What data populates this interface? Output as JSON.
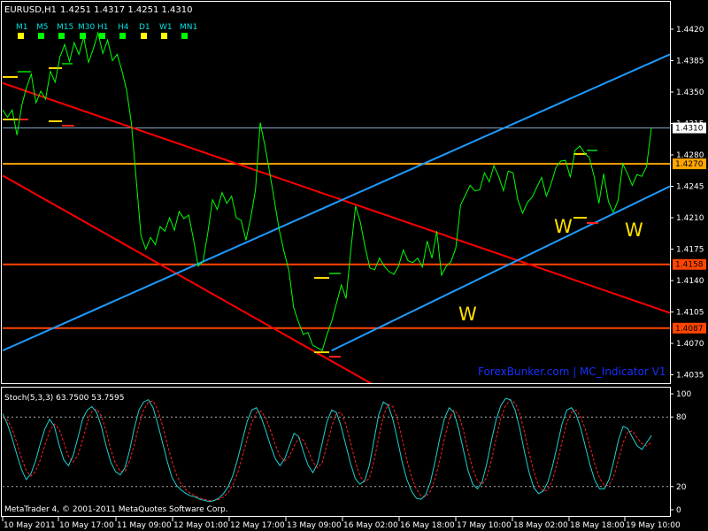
{
  "header": {
    "symbol": "EURUSD,H1",
    "ohlc": "1.4251 1.4317 1.4251 1.4310"
  },
  "timeframes": {
    "labels": [
      "M1",
      "M5",
      "M15",
      "M30",
      "H1",
      "H4",
      "D1",
      "W1",
      "MN1"
    ],
    "status_colors": [
      "#ffff00",
      "#00ff00",
      "#00ff00",
      "#00ff00",
      "#00ff00",
      "#00ff00",
      "#ffff00",
      "#ffff00",
      "#00ff00"
    ]
  },
  "watermark": "ForexBunker.com | MC_Indicator V1",
  "footer": "MetaTrader 4, © 2001-2011 MetaQuotes Software Corp.",
  "wave_labels": [
    "W",
    "W",
    "W"
  ],
  "chart_data": [
    {
      "type": "line",
      "name": "price",
      "ylim": [
        1.4015,
        1.4465
      ],
      "y_ticks": [
        "1.4420",
        "1.4385",
        "1.4350",
        "1.4315",
        "1.4280",
        "1.4245",
        "1.4210",
        "1.4175",
        "1.4140",
        "1.4105",
        "1.4070",
        "1.4035"
      ],
      "x_ticks": [
        "10 May 2011",
        "10 May 17:00",
        "11 May 09:00",
        "12 May 01:00",
        "12 May 17:00",
        "13 May 09:00",
        "16 May 02:00",
        "16 May 18:00",
        "17 May 10:00",
        "18 May 02:00",
        "18 May 18:00",
        "19 May 10:00"
      ],
      "colors": {
        "price": "#00ff00",
        "resistance": "#ff0000",
        "support": "#1e9bff",
        "level_orange": "#ffa500",
        "level_red": "#ff4500",
        "current": "#87a9c9"
      },
      "current_price": 1.431,
      "current_price_label": "1.4310",
      "horizontal_levels": [
        {
          "value": 1.427,
          "label": "1.4270",
          "color": "#ffa500"
        },
        {
          "value": 1.4158,
          "label": "1.4158",
          "color": "#ff4500"
        },
        {
          "value": 1.4087,
          "label": "1.4087",
          "color": "#ff4500"
        }
      ],
      "trendlines": [
        {
          "color": "#ff0000",
          "from": [
            0,
            1.436
          ],
          "to": [
            1,
            1.4104
          ]
        },
        {
          "color": "#ff0000",
          "from": [
            0,
            1.4257
          ],
          "to": [
            0.565,
            1.402
          ]
        },
        {
          "color": "#1e9bff",
          "from": [
            0,
            1.4062
          ],
          "to": [
            1,
            1.4392
          ]
        },
        {
          "color": "#1e9bff",
          "from": [
            0.493,
            1.4062
          ],
          "to": [
            1,
            1.4245
          ]
        }
      ],
      "series": [
        {
          "values": [
            1.433,
            1.4322,
            1.433,
            1.4302,
            1.4335,
            1.4355,
            1.437,
            1.4338,
            1.4351,
            1.4342,
            1.4373,
            1.4361,
            1.4389,
            1.4403,
            1.4384,
            1.4405,
            1.4392,
            1.4411,
            1.4383,
            1.4398,
            1.4416,
            1.4393,
            1.4408,
            1.4385,
            1.4392,
            1.4374,
            1.4352,
            1.4315,
            1.4253,
            1.419,
            1.4175,
            1.4188,
            1.418,
            1.42,
            1.4195,
            1.421,
            1.4196,
            1.4217,
            1.4209,
            1.4213,
            1.4186,
            1.4156,
            1.4161,
            1.4193,
            1.423,
            1.4219,
            1.4238,
            1.4226,
            1.4234,
            1.421,
            1.4207,
            1.4185,
            1.421,
            1.4241,
            1.4316,
            1.429,
            1.426,
            1.4228,
            1.4196,
            1.4172,
            1.4151,
            1.411,
            1.4094,
            1.408,
            1.4082,
            1.4068,
            1.4065,
            1.4062,
            1.408,
            1.4095,
            1.4115,
            1.4135,
            1.412,
            1.4174,
            1.4223,
            1.4205,
            1.4177,
            1.4154,
            1.4152,
            1.4165,
            1.4156,
            1.415,
            1.4147,
            1.4156,
            1.4174,
            1.4162,
            1.416,
            1.4165,
            1.4155,
            1.4184,
            1.4165,
            1.4195,
            1.4146,
            1.4156,
            1.4161,
            1.4176,
            1.4224,
            1.4235,
            1.4246,
            1.424,
            1.4241,
            1.426,
            1.425,
            1.4268,
            1.4256,
            1.424,
            1.4262,
            1.426,
            1.423,
            1.4215,
            1.4227,
            1.4233,
            1.4244,
            1.4255,
            1.4234,
            1.4248,
            1.4266,
            1.4273,
            1.4274,
            1.4255,
            1.4285,
            1.429,
            1.4282,
            1.4277,
            1.4256,
            1.4226,
            1.4259,
            1.4228,
            1.4216,
            1.4229,
            1.427,
            1.4259,
            1.4246,
            1.4258,
            1.4256,
            1.4267,
            1.431
          ]
        }
      ]
    },
    {
      "type": "line",
      "name": "stochastic",
      "title": "Stoch(5,3,3) 63.7500 53.7595",
      "ylim": [
        0,
        100
      ],
      "y_ticks": [
        "100",
        "80",
        "20",
        "0"
      ],
      "levels": [
        80,
        20
      ],
      "colors": {
        "main": "#20d0d0",
        "signal": "#ff2020"
      },
      "series": [
        {
          "values": [
            83,
            74,
            62,
            48,
            35,
            26,
            31,
            42,
            57,
            70,
            78,
            72,
            56,
            43,
            38,
            47,
            62,
            78,
            86,
            89,
            84,
            72,
            55,
            41,
            33,
            30,
            36,
            51,
            70,
            86,
            93,
            95,
            88,
            74,
            58,
            42,
            28,
            21,
            17,
            14,
            12,
            11,
            9,
            8,
            7,
            8,
            10,
            14,
            20,
            30,
            44,
            60,
            76,
            86,
            88,
            80,
            68,
            55,
            44,
            38,
            44,
            55,
            66,
            63,
            50,
            38,
            32,
            40,
            58,
            76,
            86,
            84,
            72,
            56,
            40,
            27,
            22,
            25,
            38,
            60,
            82,
            93,
            90,
            78,
            60,
            41,
            26,
            16,
            10,
            9,
            13,
            24,
            42,
            62,
            79,
            88,
            84,
            70,
            52,
            34,
            22,
            18,
            24,
            40,
            60,
            78,
            90,
            96,
            95,
            86,
            70,
            50,
            32,
            19,
            14,
            16,
            24,
            38,
            56,
            74,
            86,
            88,
            82,
            70,
            54,
            38,
            25,
            18,
            18,
            26,
            42,
            60,
            72,
            70,
            62,
            55,
            52,
            58,
            64
          ]
        },
        {
          "values": [
            80,
            78,
            70,
            58,
            45,
            34,
            29,
            33,
            43,
            56,
            68,
            74,
            70,
            58,
            46,
            41,
            47,
            60,
            75,
            85,
            87,
            81,
            68,
            52,
            40,
            33,
            33,
            42,
            56,
            73,
            86,
            93,
            94,
            86,
            73,
            57,
            42,
            30,
            22,
            17,
            14,
            12,
            10,
            9,
            8,
            8,
            9,
            11,
            15,
            22,
            32,
            46,
            61,
            75,
            84,
            85,
            79,
            68,
            56,
            46,
            42,
            46,
            55,
            62,
            60,
            51,
            41,
            36,
            41,
            56,
            72,
            83,
            84,
            74,
            58,
            42,
            29,
            24,
            27,
            42,
            62,
            81,
            91,
            89,
            78,
            61,
            43,
            28,
            18,
            12,
            11,
            16,
            27,
            43,
            62,
            78,
            86,
            82,
            69,
            51,
            35,
            25,
            22,
            28,
            43,
            62,
            79,
            90,
            95,
            92,
            83,
            67,
            49,
            33,
            21,
            16,
            17,
            26,
            41,
            59,
            75,
            84,
            86,
            80,
            69,
            54,
            39,
            27,
            21,
            21,
            29,
            43,
            58,
            67,
            68,
            62,
            57,
            55,
            58
          ]
        }
      ]
    }
  ]
}
